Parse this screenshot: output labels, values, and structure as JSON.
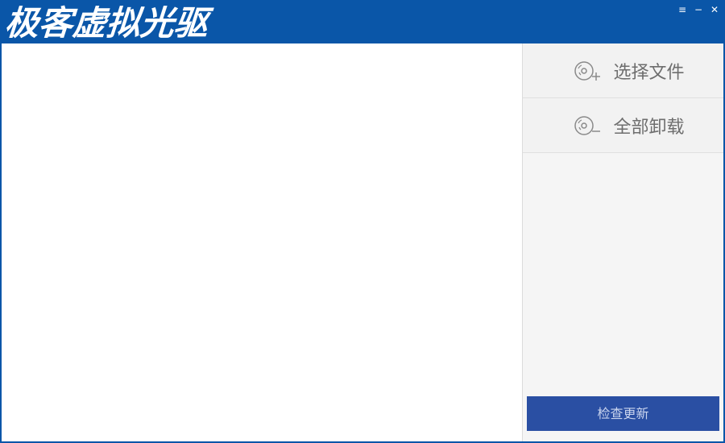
{
  "window": {
    "title": "极客虚拟光驱",
    "controls": {
      "menu": "≡",
      "minimize": "−",
      "close": "✕"
    }
  },
  "sidebar": {
    "items": [
      {
        "label": "选择文件",
        "icon": "disc-add-icon"
      },
      {
        "label": "全部卸载",
        "icon": "disc-remove-icon"
      }
    ],
    "update_label": "检查更新"
  },
  "colors": {
    "titlebar": "#0a56a8",
    "update_button": "#2a4fa3",
    "sidebar_bg": "#f5f5f5",
    "sidebar_text": "#6e6e6e"
  }
}
